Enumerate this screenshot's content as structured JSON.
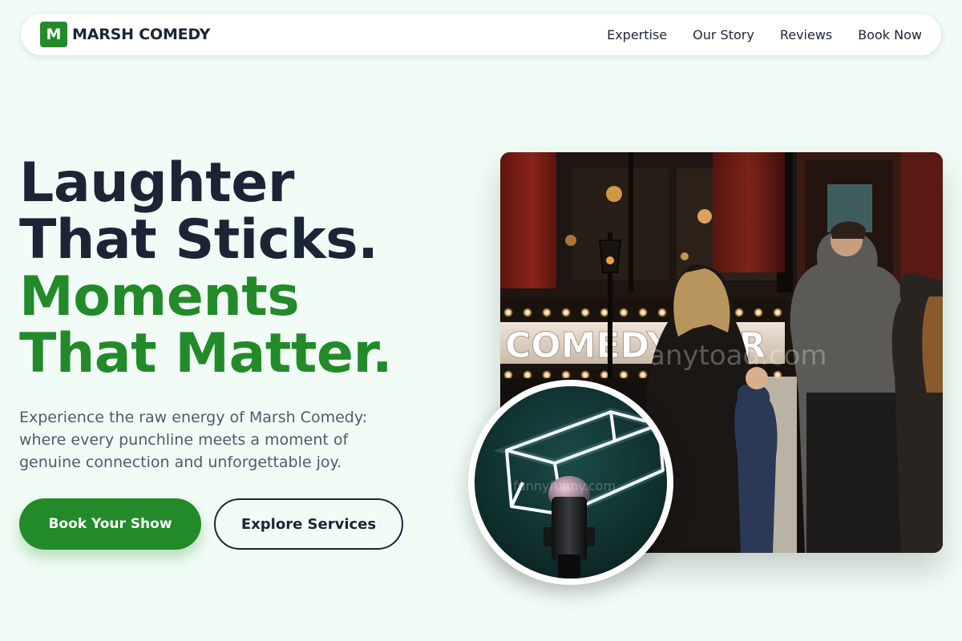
{
  "brand": {
    "mark": "M",
    "name": "MARSH COMEDY"
  },
  "nav": {
    "links": [
      "Expertise",
      "Our Story",
      "Reviews",
      "Book Now"
    ]
  },
  "hero": {
    "headline_dark": [
      "Laughter",
      "That Sticks."
    ],
    "headline_green": [
      "Moments",
      "That Matter."
    ],
    "lead": "Experience the raw energy of Marsh Comedy: where every punchline meets a moment of genuine connection and unforgettable joy.",
    "primary_cta": "Book Your Show",
    "secondary_cta": "Explore Services"
  },
  "images": {
    "main_sign_text": "COMEDY BAR",
    "main_watermark": "anytoad.com",
    "circle_watermark": "funnyfunny.com"
  },
  "colors": {
    "accent": "#238a2a",
    "text_dark": "#1c2536",
    "text_muted": "#4d5a6c",
    "background": "#f2fcf6"
  }
}
